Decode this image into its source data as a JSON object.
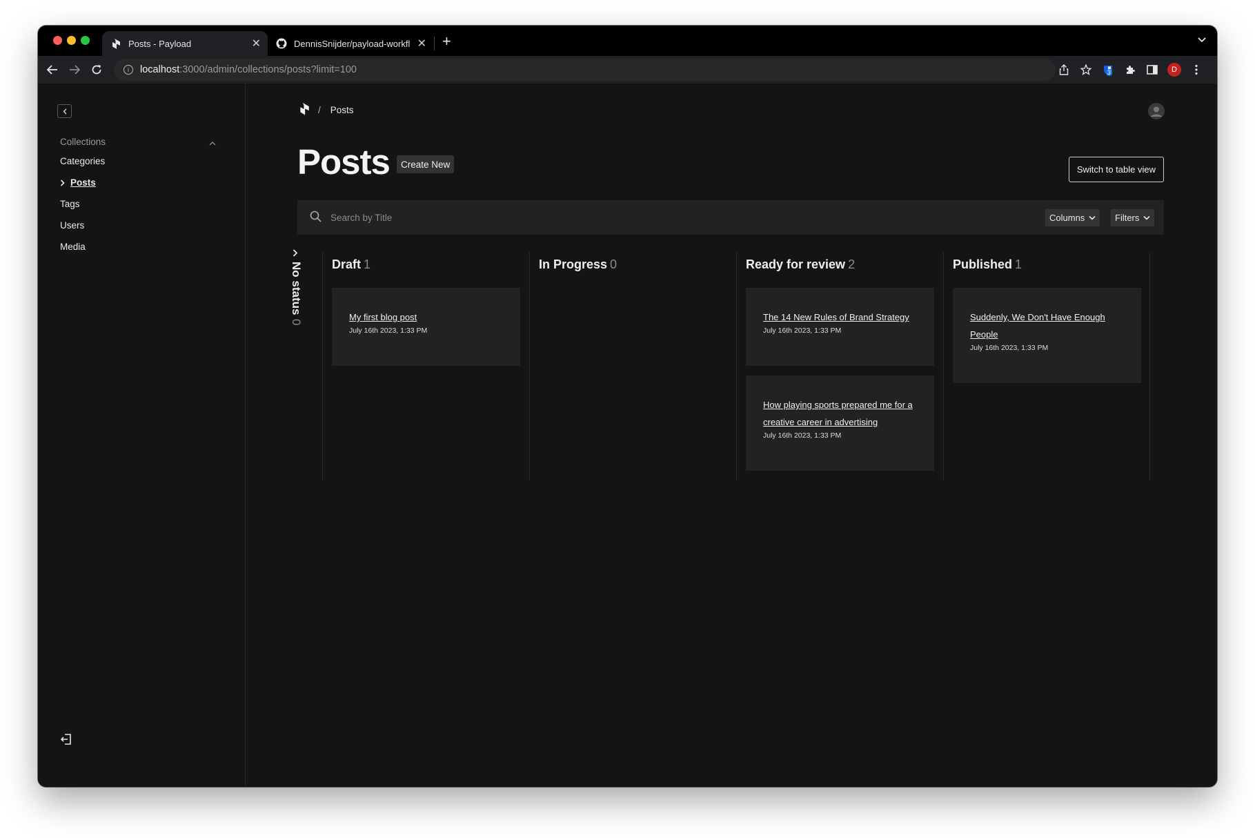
{
  "browser": {
    "tabs": [
      {
        "title": "Posts - Payload",
        "icon": "payload-logo-icon",
        "active": true
      },
      {
        "title": "DennisSnijder/payload-workfl",
        "icon": "github-icon",
        "active": false
      }
    ],
    "url_host": "localhost",
    "url_path": ":3000/admin/collections/posts?limit=100",
    "extension_badge": "3",
    "profile_initial": "D"
  },
  "sidebar": {
    "group_label": "Collections",
    "items": [
      {
        "label": "Categories"
      },
      {
        "label": "Posts",
        "active": true
      },
      {
        "label": "Tags"
      },
      {
        "label": "Users"
      },
      {
        "label": "Media"
      }
    ]
  },
  "breadcrumb": {
    "separator": "/",
    "current": "Posts"
  },
  "header": {
    "title": "Posts",
    "create_new_label": "Create New",
    "switch_view_label": "Switch to table view"
  },
  "search": {
    "placeholder": "Search by Title",
    "columns_label": "Columns",
    "filters_label": "Filters"
  },
  "board": {
    "no_status": {
      "label": "No status",
      "count": "0"
    },
    "columns": [
      {
        "title": "Draft",
        "count": "1",
        "cards": [
          {
            "title": "My first blog post",
            "date": "July 16th 2023, 1:33 PM"
          }
        ]
      },
      {
        "title": "In Progress",
        "count": "0",
        "cards": []
      },
      {
        "title": "Ready for review",
        "count": "2",
        "cards": [
          {
            "title": "The 14 New Rules of Brand Strategy",
            "date": "July 16th 2023, 1:33 PM"
          },
          {
            "title": "How playing sports prepared me for a creative career in advertising",
            "date": "July 16th 2023, 1:33 PM"
          }
        ]
      },
      {
        "title": "Published",
        "count": "1",
        "cards": [
          {
            "title": "Suddenly, We Don't Have Enough People",
            "date": "July 16th 2023, 1:33 PM"
          }
        ]
      }
    ]
  },
  "colors": {
    "background": "#141414",
    "card": "#222222",
    "muted_text": "#8a8a8a",
    "traffic_red": "#ff5f57",
    "traffic_yellow": "#febc2e",
    "traffic_green": "#28c840"
  }
}
